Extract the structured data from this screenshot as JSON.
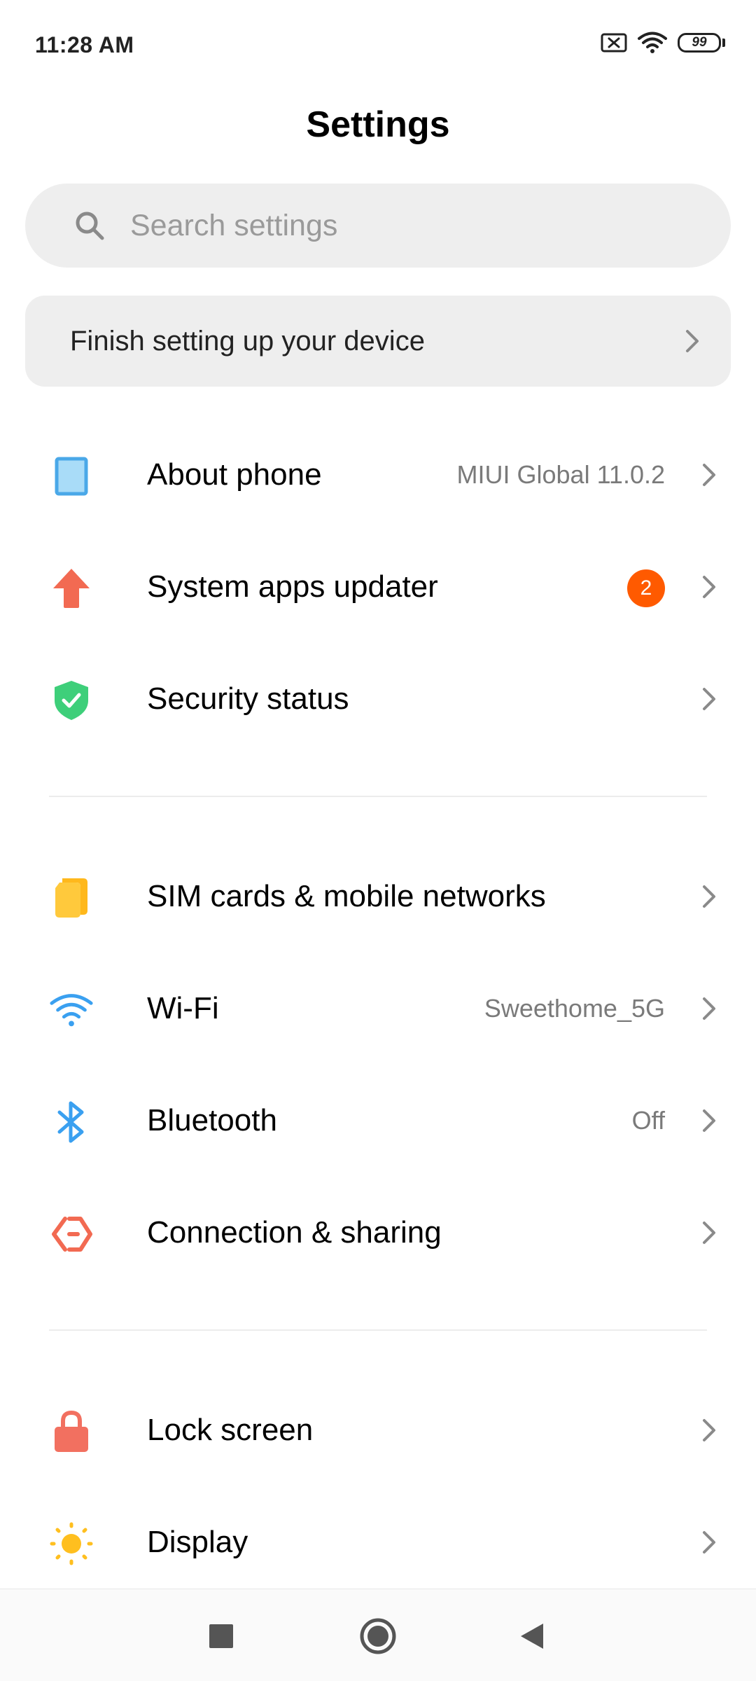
{
  "status_bar": {
    "time": "11:28 AM",
    "battery": "99",
    "icons": [
      "sim-x-icon",
      "wifi-icon",
      "battery-icon"
    ]
  },
  "header": {
    "title": "Settings"
  },
  "search": {
    "placeholder": "Search settings",
    "value": ""
  },
  "setup_card": {
    "label": "Finish setting up your device"
  },
  "sections": [
    {
      "items": [
        {
          "label": "About phone",
          "value": "MIUI Global 11.0.2",
          "icon": "phone-icon"
        },
        {
          "label": "System apps updater",
          "badge": "2",
          "icon": "update-arrow-icon"
        },
        {
          "label": "Security status",
          "icon": "shield-check-icon"
        }
      ]
    },
    {
      "items": [
        {
          "label": "SIM cards & mobile networks",
          "icon": "sim-card-icon"
        },
        {
          "label": "Wi-Fi",
          "value": "Sweethome_5G",
          "icon": "wifi-icon"
        },
        {
          "label": "Bluetooth",
          "value": "Off",
          "icon": "bluetooth-icon"
        },
        {
          "label": "Connection & sharing",
          "icon": "connection-sharing-icon"
        }
      ]
    },
    {
      "items": [
        {
          "label": "Lock screen",
          "icon": "lock-icon"
        },
        {
          "label": "Display",
          "icon": "sun-icon"
        }
      ]
    }
  ],
  "nav_bar": {
    "buttons": [
      "recents-button",
      "home-button",
      "back-button"
    ]
  },
  "colors": {
    "accent_orange": "#ff5a00",
    "phone_blue": "#4aa8e8",
    "arrow_red": "#f26a52",
    "shield_green": "#3ecf7a",
    "sim_yellow": "#ffc93c",
    "wifi_blue": "#3aa0f0",
    "lock_red": "#f27060",
    "sun_yellow": "#ffbf1f"
  }
}
